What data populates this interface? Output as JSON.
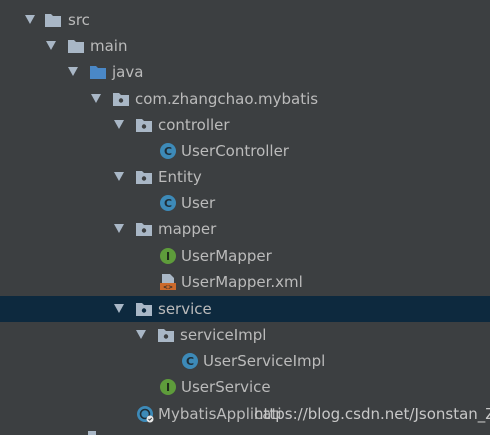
{
  "tree": [
    {
      "label": "src",
      "icon": "folder-icon",
      "arrow": true
    },
    {
      "label": "main",
      "icon": "folder-icon",
      "arrow": true
    },
    {
      "label": "java",
      "icon": "source-folder-icon",
      "arrow": true
    },
    {
      "label": "com.zhangchao.mybatis",
      "icon": "package-icon",
      "arrow": true
    },
    {
      "label": "controller",
      "icon": "package-icon",
      "arrow": true
    },
    {
      "label": "UserController",
      "icon": "class-icon",
      "arrow": false
    },
    {
      "label": "Entity",
      "icon": "package-icon",
      "arrow": true
    },
    {
      "label": "User",
      "icon": "class-icon",
      "arrow": false
    },
    {
      "label": "mapper",
      "icon": "package-icon",
      "arrow": true
    },
    {
      "label": "UserMapper",
      "icon": "interface-icon",
      "arrow": false
    },
    {
      "label": "UserMapper.xml",
      "icon": "xml-file-icon",
      "arrow": false
    },
    {
      "label": "service",
      "icon": "package-icon",
      "arrow": true,
      "selected": true
    },
    {
      "label": "serviceImpl",
      "icon": "package-icon",
      "arrow": true
    },
    {
      "label": "UserServiceImpl",
      "icon": "class-icon",
      "arrow": false
    },
    {
      "label": "UserService",
      "icon": "interface-icon",
      "arrow": false
    },
    {
      "label": "MybatisApplicati",
      "icon": "spring-app-icon",
      "arrow": false
    }
  ],
  "watermark": "https://blog.csdn.net/Jsonstan_Z"
}
